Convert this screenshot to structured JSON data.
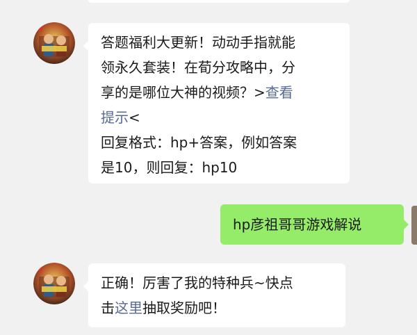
{
  "messages": [
    {
      "side": "left",
      "text_parts": {
        "line1": "答题福利大更新！动动手指就能",
        "line2": "领永久套装！在荀分攻略中，分",
        "line3a": "享的是哪位大神的视频？>",
        "link1a": "查看",
        "link1b": "提示",
        "line4b": "<",
        "line5": "回复格式：hp+答案，例如答案",
        "line6": "是10，则回复：hp10"
      }
    },
    {
      "side": "right",
      "text": "hp彦祖哥哥游戏解说"
    },
    {
      "side": "left",
      "text_parts": {
        "line1": "正确！厉害了我的特种兵~快点",
        "line2a": "击",
        "link": "这里",
        "line2b": "抽取奖励吧！"
      }
    }
  ],
  "avatar_icon": "game-character-avatar-icon",
  "colors": {
    "background": "#f1f1f1",
    "bubble_left": "#ffffff",
    "bubble_right": "#95ec69",
    "link": "#576b95"
  }
}
